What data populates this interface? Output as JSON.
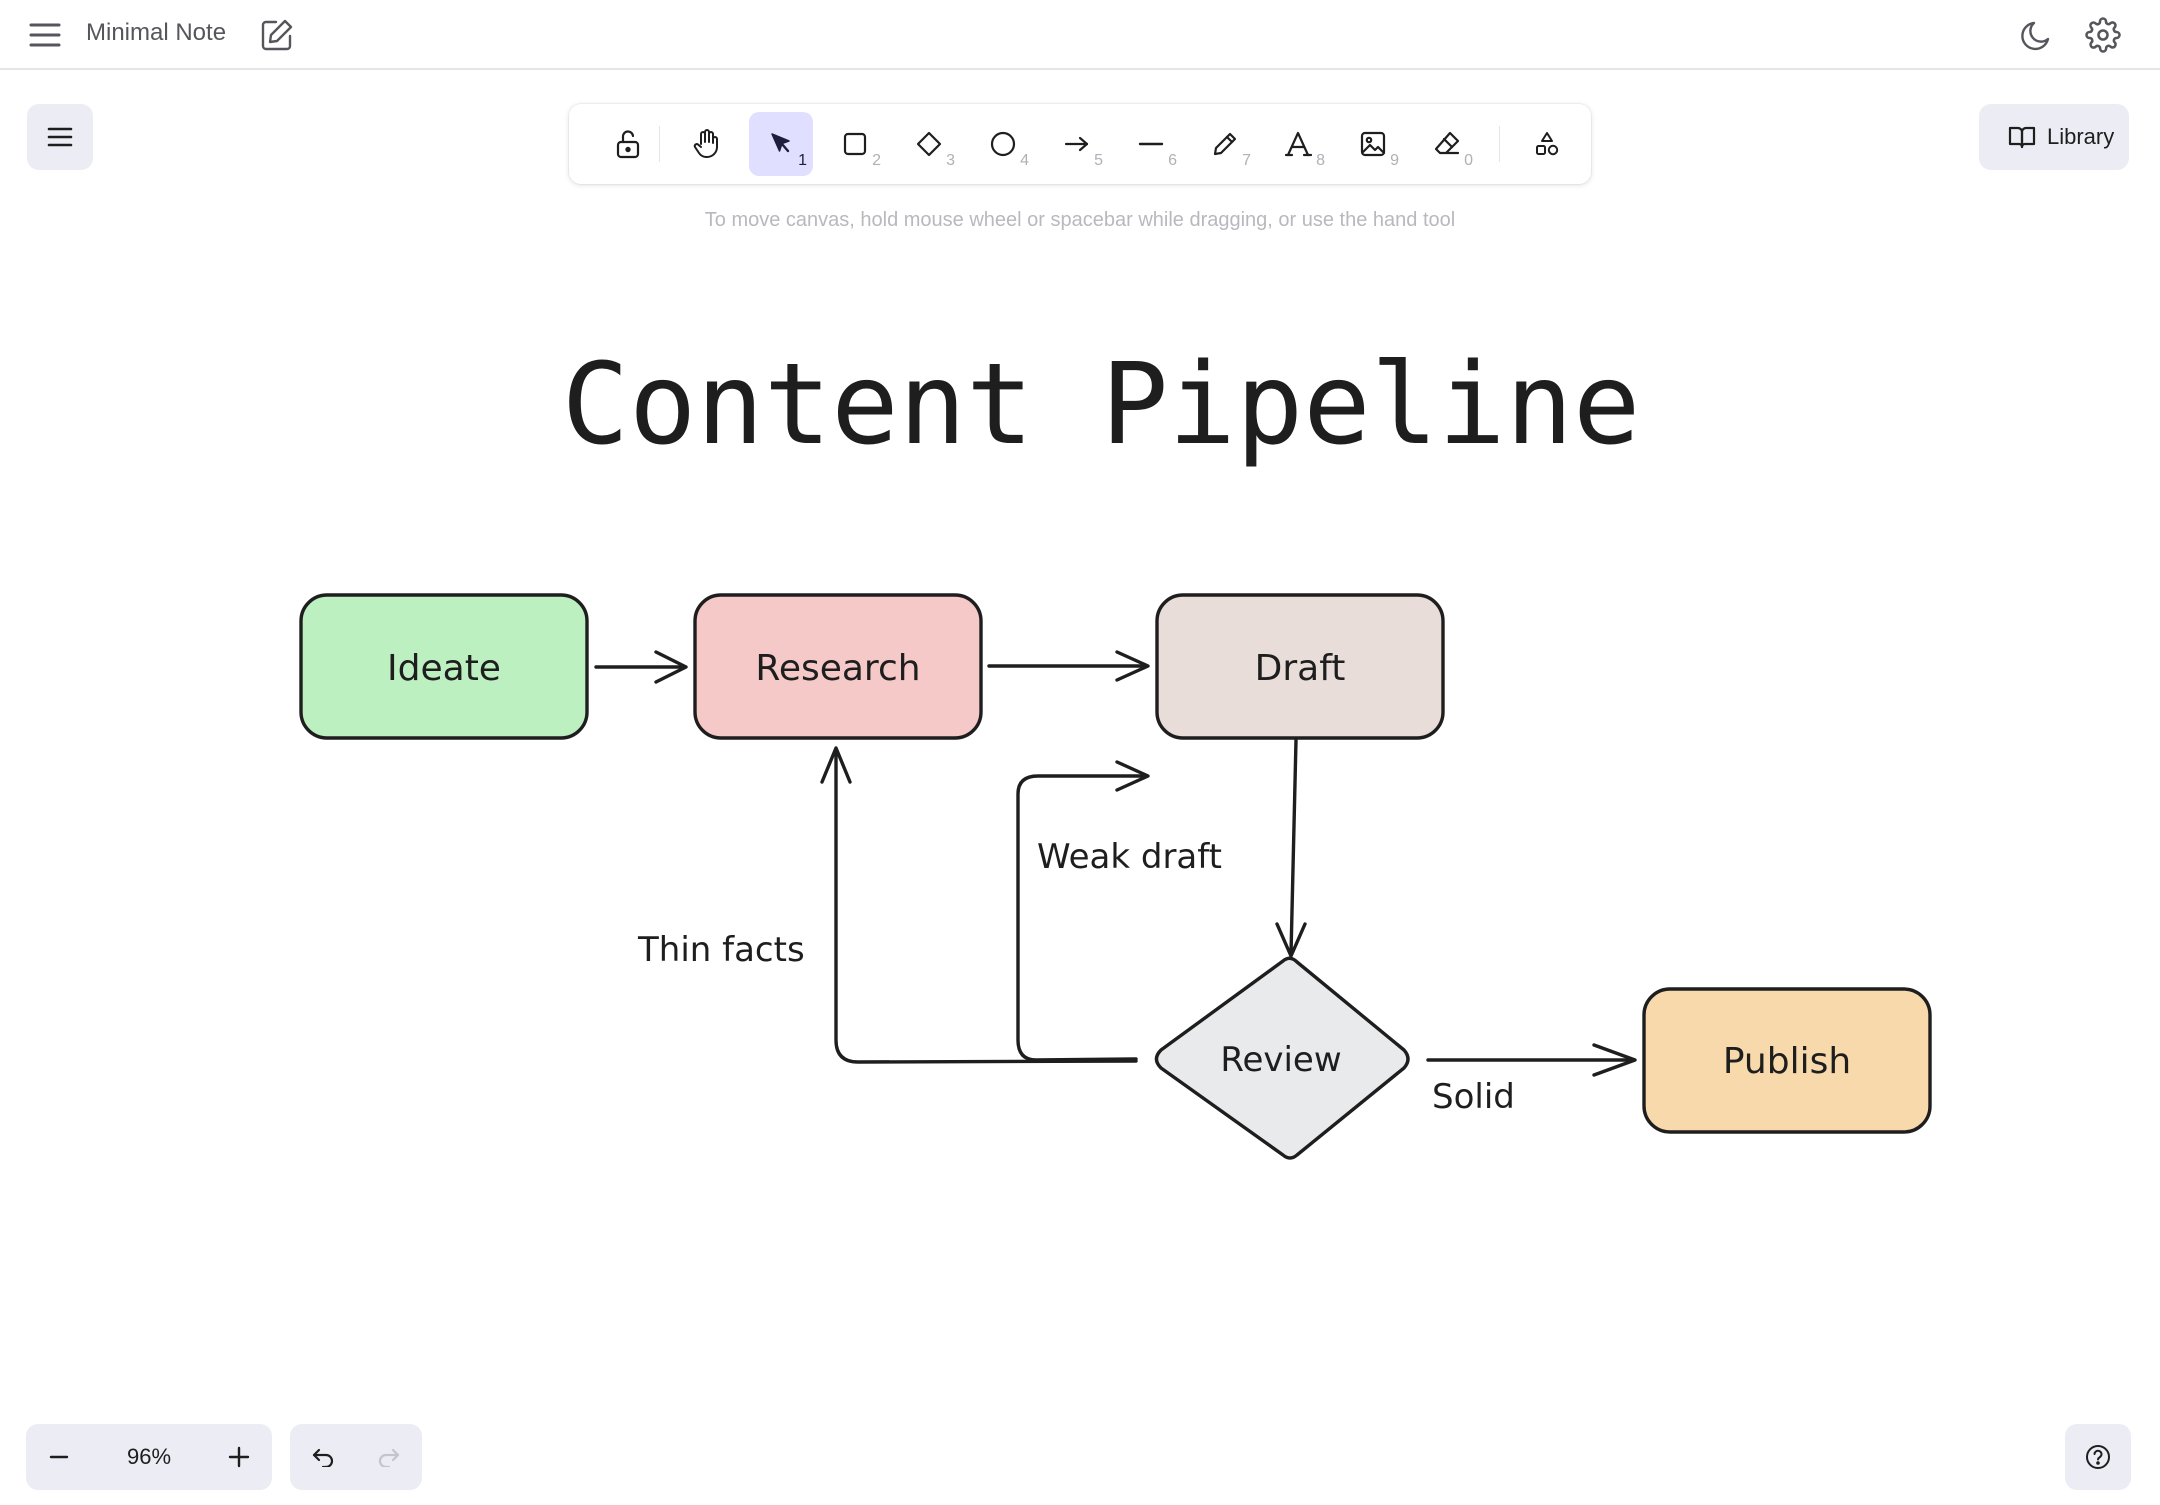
{
  "app": {
    "title": "Minimal Note"
  },
  "toolbar": {
    "tools": [
      {
        "name": "select",
        "key": "1"
      },
      {
        "name": "rectangle",
        "key": "2"
      },
      {
        "name": "diamond",
        "key": "3"
      },
      {
        "name": "ellipse",
        "key": "4"
      },
      {
        "name": "arrow",
        "key": "5"
      },
      {
        "name": "line",
        "key": "6"
      },
      {
        "name": "draw",
        "key": "7"
      },
      {
        "name": "text",
        "key": "8"
      },
      {
        "name": "image",
        "key": "9"
      },
      {
        "name": "eraser",
        "key": "0"
      }
    ],
    "active_tool": "select"
  },
  "hint": "To move canvas, hold mouse wheel or spacebar while dragging, or use the hand tool",
  "library": {
    "label": "Library"
  },
  "drawing": {
    "title": "Content Pipeline",
    "nodes": {
      "ideate": {
        "label": "Ideate",
        "fill": "#bdf0c0"
      },
      "research": {
        "label": "Research",
        "fill": "#f6c9c9"
      },
      "draft": {
        "label": "Draft",
        "fill": "#e8ddd8"
      },
      "review": {
        "label": "Review",
        "fill": "#e9eaec"
      },
      "publish": {
        "label": "Publish",
        "fill": "#f8d9ac"
      }
    },
    "edge_labels": {
      "weak_draft": "Weak draft",
      "thin_facts": "Thin facts",
      "solid": "Solid"
    },
    "stroke_color": "#1e1e1e"
  },
  "zoom": {
    "value": "96%"
  },
  "colors": {
    "accent": "#e0dfff",
    "panel": "#ececf4"
  }
}
